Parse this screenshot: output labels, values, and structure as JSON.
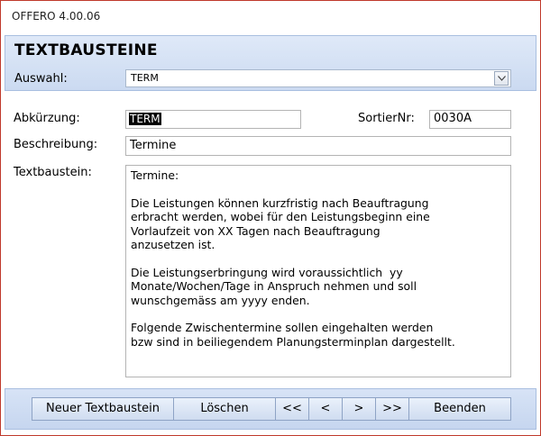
{
  "window": {
    "title": "OFFERO 4.00.06"
  },
  "header": {
    "title": "TEXTBAUSTEINE",
    "auswahl_label": "Auswahl:",
    "auswahl_value": "TERM"
  },
  "form": {
    "abk_label": "Abkürzung:",
    "abk_value": "TERM",
    "sortier_label": "SortierNr:",
    "sortier_value": "0030A",
    "beschreibung_label": "Beschreibung:",
    "beschreibung_value": "Termine",
    "textbaustein_label": "Textbaustein:",
    "textbaustein_value": "Termine:\n\nDie Leistungen können kurzfristig nach Beauftragung\nerbracht werden, wobei für den Leistungsbeginn eine\nVorlaufzeit von XX Tagen nach Beauftragung\nanzusetzen ist.\n\nDie Leistungserbringung wird voraussichtlich  yy\nMonate/Wochen/Tage in Anspruch nehmen und soll\nwunschgemäss am yyyy enden.\n\nFolgende Zwischentermine sollen eingehalten werden\nbzw sind in beiliegendem Planungsterminplan dargestellt."
  },
  "footer": {
    "new_label": "Neuer Textbaustein",
    "delete_label": "Löschen",
    "first_label": "<<",
    "prev_label": "<",
    "next_label": ">",
    "last_label": ">>",
    "exit_label": "Beenden"
  }
}
